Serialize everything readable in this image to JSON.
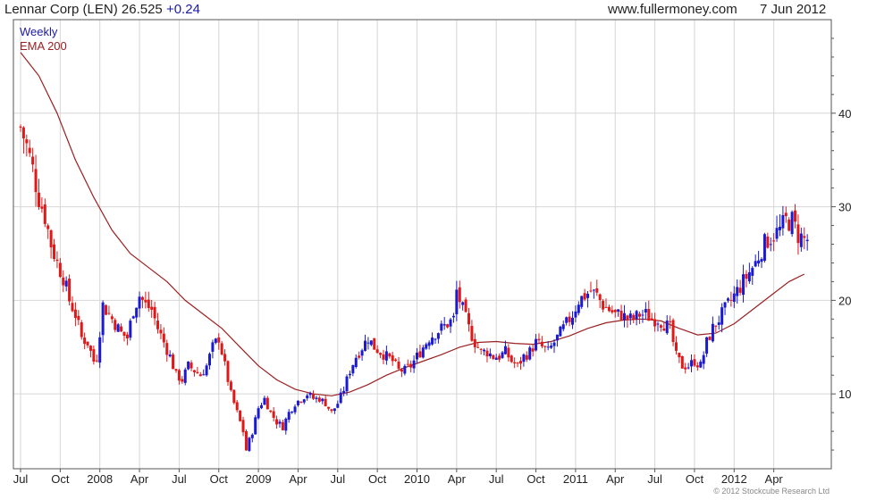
{
  "header": {
    "title": "Lennar Corp (LEN) 26.525",
    "change": "+0.24",
    "site": "www.fullermoney.com",
    "date": "7 Jun 2012"
  },
  "footer": {
    "copyright": "© 2012 Stockcube Research Ltd"
  },
  "colors": {
    "up": "#1a1ad0",
    "down": "#e01818",
    "ema": "#9b2020",
    "grid": "#d6d6d6",
    "frame": "#555555",
    "legend_weekly": "#1a1aa8"
  },
  "chart_data": {
    "type": "candlestick",
    "title": "Lennar Corp (LEN)",
    "legend": [
      "Weekly",
      "EMA 200"
    ],
    "legend_position": "top-left",
    "y_axis_side": "right",
    "ylim": [
      2,
      50
    ],
    "yticks": [
      10,
      20,
      30,
      40
    ],
    "grid": true,
    "x_range_weeks": [
      0,
      260
    ],
    "xticks": [
      {
        "label": "Jul",
        "week": 0
      },
      {
        "label": "Oct",
        "week": 13
      },
      {
        "label": "2008",
        "week": 26
      },
      {
        "label": "Apr",
        "week": 39
      },
      {
        "label": "Jul",
        "week": 52
      },
      {
        "label": "Oct",
        "week": 65
      },
      {
        "label": "2009",
        "week": 78
      },
      {
        "label": "Apr",
        "week": 91
      },
      {
        "label": "Jul",
        "week": 104
      },
      {
        "label": "Oct",
        "week": 117
      },
      {
        "label": "2010",
        "week": 130
      },
      {
        "label": "Apr",
        "week": 143
      },
      {
        "label": "Jul",
        "week": 156
      },
      {
        "label": "Oct",
        "week": 169
      },
      {
        "label": "2011",
        "week": 182
      },
      {
        "label": "Apr",
        "week": 195
      },
      {
        "label": "Jul",
        "week": 208
      },
      {
        "label": "Oct",
        "week": 221
      },
      {
        "label": "2012",
        "week": 234
      },
      {
        "label": "Apr",
        "week": 247
      }
    ],
    "price_path": [
      [
        0,
        38.5
      ],
      [
        2,
        36.5
      ],
      [
        4,
        34
      ],
      [
        6,
        31
      ],
      [
        8,
        29
      ],
      [
        10,
        26
      ],
      [
        12,
        24
      ],
      [
        14,
        22.5
      ],
      [
        16,
        20
      ],
      [
        18,
        18.5
      ],
      [
        20,
        16
      ],
      [
        22,
        15.5
      ],
      [
        24,
        13.5
      ],
      [
        25,
        14
      ],
      [
        27,
        19.5
      ],
      [
        29,
        18.5
      ],
      [
        31,
        17.5
      ],
      [
        33,
        16.5
      ],
      [
        35,
        16
      ],
      [
        37,
        19
      ],
      [
        39,
        20.5
      ],
      [
        41,
        19.5
      ],
      [
        43,
        19
      ],
      [
        45,
        17
      ],
      [
        47,
        15.5
      ],
      [
        49,
        14
      ],
      [
        51,
        12
      ],
      [
        53,
        11.5
      ],
      [
        55,
        13
      ],
      [
        57,
        12.5
      ],
      [
        59,
        12
      ],
      [
        61,
        13
      ],
      [
        63,
        15
      ],
      [
        65,
        16
      ],
      [
        67,
        13
      ],
      [
        69,
        10
      ],
      [
        71,
        8
      ],
      [
        73,
        6
      ],
      [
        74,
        4
      ],
      [
        76,
        6
      ],
      [
        78,
        8.5
      ],
      [
        80,
        9.5
      ],
      [
        82,
        8
      ],
      [
        84,
        7
      ],
      [
        86,
        6.5
      ],
      [
        88,
        8
      ],
      [
        90,
        9
      ],
      [
        92,
        9.5
      ],
      [
        94,
        10
      ],
      [
        96,
        9.5
      ],
      [
        98,
        9.5
      ],
      [
        100,
        9
      ],
      [
        102,
        8
      ],
      [
        104,
        9
      ],
      [
        106,
        10.5
      ],
      [
        108,
        12.5
      ],
      [
        110,
        14
      ],
      [
        112,
        15
      ],
      [
        114,
        16
      ],
      [
        116,
        15
      ],
      [
        118,
        14.5
      ],
      [
        120,
        14
      ],
      [
        122,
        13.5
      ],
      [
        124,
        12.5
      ],
      [
        126,
        12.5
      ],
      [
        128,
        13
      ],
      [
        130,
        14
      ],
      [
        132,
        15
      ],
      [
        134,
        16
      ],
      [
        136,
        16.5
      ],
      [
        138,
        17
      ],
      [
        140,
        17.5
      ],
      [
        142,
        18
      ],
      [
        143,
        21
      ],
      [
        145,
        19
      ],
      [
        147,
        17
      ],
      [
        149,
        15.5
      ],
      [
        151,
        14.5
      ],
      [
        153,
        14.5
      ],
      [
        155,
        14
      ],
      [
        157,
        14
      ],
      [
        159,
        14.5
      ],
      [
        161,
        13.5
      ],
      [
        163,
        13
      ],
      [
        165,
        14
      ],
      [
        167,
        14.5
      ],
      [
        169,
        15.5
      ],
      [
        171,
        15
      ],
      [
        173,
        14.5
      ],
      [
        175,
        15.5
      ],
      [
        177,
        16.5
      ],
      [
        179,
        17.5
      ],
      [
        181,
        18.5
      ],
      [
        183,
        20
      ],
      [
        185,
        20.5
      ],
      [
        187,
        21
      ],
      [
        189,
        20.5
      ],
      [
        191,
        19.5
      ],
      [
        193,
        19
      ],
      [
        195,
        18.5
      ],
      [
        197,
        18.5
      ],
      [
        199,
        18
      ],
      [
        201,
        18
      ],
      [
        203,
        18.5
      ],
      [
        205,
        18.5
      ],
      [
        207,
        18
      ],
      [
        209,
        18
      ],
      [
        211,
        17.5
      ],
      [
        213,
        17
      ],
      [
        215,
        14
      ],
      [
        217,
        13
      ],
      [
        219,
        13
      ],
      [
        221,
        13.5
      ],
      [
        223,
        13
      ],
      [
        225,
        15.5
      ],
      [
        227,
        17
      ],
      [
        229,
        18
      ],
      [
        231,
        19
      ],
      [
        233,
        20
      ],
      [
        235,
        21
      ],
      [
        237,
        22
      ],
      [
        239,
        23
      ],
      [
        241,
        24
      ],
      [
        243,
        25.5
      ],
      [
        245,
        26.5
      ],
      [
        247,
        27
      ],
      [
        249,
        27.5
      ],
      [
        251,
        28.5
      ],
      [
        253,
        28.5
      ],
      [
        255,
        27
      ],
      [
        257,
        26.5
      ],
      [
        258,
        26.5
      ]
    ],
    "ema200_path": [
      [
        0,
        46.5
      ],
      [
        6,
        44
      ],
      [
        12,
        40
      ],
      [
        18,
        35
      ],
      [
        24,
        31
      ],
      [
        30,
        27.5
      ],
      [
        36,
        25
      ],
      [
        42,
        23.5
      ],
      [
        48,
        22
      ],
      [
        54,
        20
      ],
      [
        60,
        18.5
      ],
      [
        66,
        17
      ],
      [
        72,
        15
      ],
      [
        78,
        13
      ],
      [
        84,
        11.5
      ],
      [
        90,
        10.5
      ],
      [
        96,
        10
      ],
      [
        102,
        9.8
      ],
      [
        108,
        10.2
      ],
      [
        114,
        11
      ],
      [
        120,
        12
      ],
      [
        126,
        12.8
      ],
      [
        132,
        13.5
      ],
      [
        138,
        14.2
      ],
      [
        144,
        15
      ],
      [
        150,
        15.5
      ],
      [
        156,
        15.6
      ],
      [
        162,
        15.4
      ],
      [
        168,
        15.3
      ],
      [
        174,
        15.6
      ],
      [
        180,
        16.2
      ],
      [
        186,
        17
      ],
      [
        192,
        17.6
      ],
      [
        198,
        17.9
      ],
      [
        204,
        18
      ],
      [
        210,
        17.8
      ],
      [
        216,
        17
      ],
      [
        222,
        16.3
      ],
      [
        228,
        16.5
      ],
      [
        234,
        17.5
      ],
      [
        240,
        19
      ],
      [
        246,
        20.5
      ],
      [
        252,
        22
      ],
      [
        257,
        22.8
      ]
    ]
  }
}
